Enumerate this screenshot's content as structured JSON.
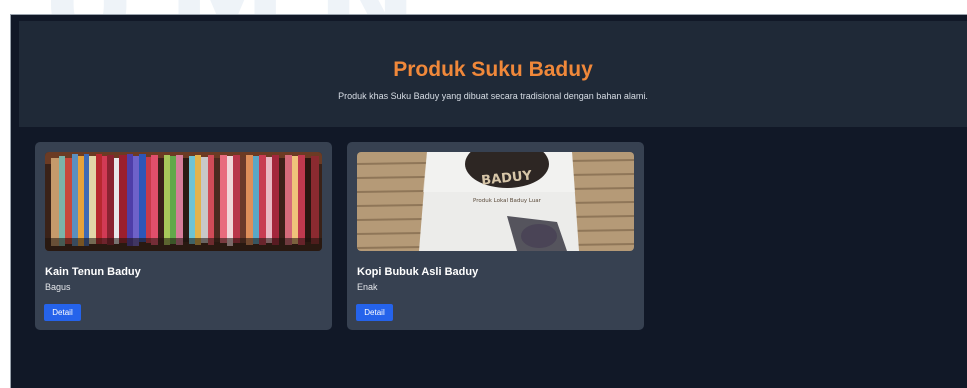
{
  "watermark": "UMN",
  "header": {
    "title": "Produk Suku Baduy",
    "subtitle": "Produk khas Suku Baduy yang dibuat secara tradisional dengan bahan alami."
  },
  "products": [
    {
      "name": "Kain Tenun Baduy",
      "description": "Bagus",
      "button_label": "Detail",
      "image": "woven-textiles-photo"
    },
    {
      "name": "Kopi Bubuk Asli Baduy",
      "description": "Enak",
      "button_label": "Detail",
      "image": "coffee-package-photo",
      "package_text": "BADUY",
      "package_label": "Produk Lokal Baduy Luar"
    }
  ],
  "colors": {
    "background": "#111827",
    "header_bg": "#1f2937",
    "card_bg": "#374151",
    "title_accent": "#f0883a",
    "button": "#2563eb"
  }
}
